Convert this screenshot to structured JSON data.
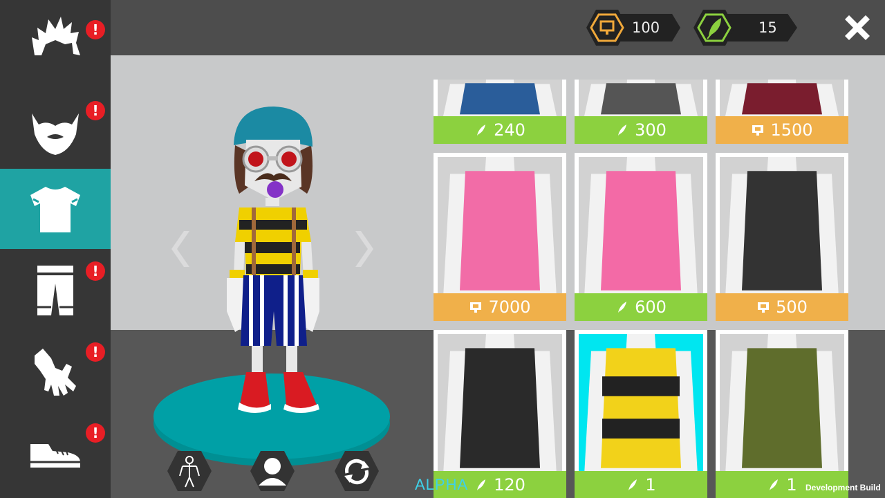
{
  "sidebar": {
    "categories": [
      {
        "name": "hair",
        "icon": "hair-icon",
        "alert": "!"
      },
      {
        "name": "beard",
        "icon": "beard-icon",
        "alert": "!"
      },
      {
        "name": "top",
        "icon": "shirt-icon",
        "active": true
      },
      {
        "name": "pants",
        "icon": "pants-icon",
        "alert": "!"
      },
      {
        "name": "gloves",
        "icon": "glove-icon",
        "alert": "!"
      },
      {
        "name": "shoes",
        "icon": "shoe-icon",
        "alert": "!"
      }
    ]
  },
  "currencies": {
    "coins": {
      "icon": "coin-icon",
      "value": "100",
      "color": "#f0a83a"
    },
    "feathers": {
      "icon": "feather-icon",
      "value": "15",
      "color": "#8cd13f"
    }
  },
  "colors": {
    "accent": "#1fa3a3",
    "price_green": "#8cd13f",
    "price_orange": "#f0b04a",
    "alert_red": "#e81e25",
    "alpha_text": "#3ed1e8"
  },
  "items": [
    {
      "price": "240",
      "currency": "feather",
      "color": "green",
      "shirt": "#2a5d9a"
    },
    {
      "price": "300",
      "currency": "feather",
      "color": "green",
      "shirt": "#555555"
    },
    {
      "price": "1500",
      "currency": "coin",
      "color": "orange",
      "shirt": "#7a1d2e"
    },
    {
      "price": "7000",
      "currency": "coin",
      "color": "orange",
      "shirt": "#f26ca7"
    },
    {
      "price": "600",
      "currency": "feather",
      "color": "green",
      "shirt": "#f36aa6"
    },
    {
      "price": "500",
      "currency": "coin",
      "color": "orange",
      "shirt": "#333333"
    },
    {
      "price": "120",
      "currency": "feather",
      "color": "green",
      "shirt": "#2a2a2a"
    },
    {
      "price": "1",
      "currency": "feather",
      "color": "green",
      "shirt": "#f2d21a",
      "selected": true
    },
    {
      "price": "1",
      "currency": "feather",
      "color": "green",
      "shirt": "#5f6d2c"
    }
  ],
  "watermarks": {
    "alpha": "ALPHA",
    "dev_build": "Development Build"
  }
}
